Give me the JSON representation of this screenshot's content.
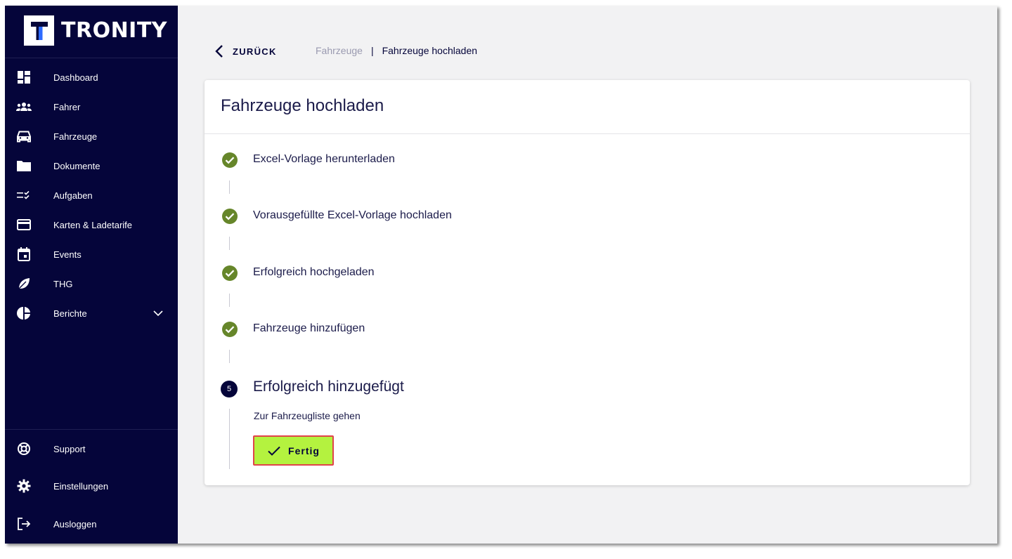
{
  "brand": {
    "logo_letter": "T",
    "name": "TRONITY"
  },
  "sidebar": {
    "items": [
      {
        "label": "Dashboard",
        "icon": "dashboard-icon"
      },
      {
        "label": "Fahrer",
        "icon": "people-icon"
      },
      {
        "label": "Fahrzeuge",
        "icon": "car-icon"
      },
      {
        "label": "Dokumente",
        "icon": "folder-icon"
      },
      {
        "label": "Aufgaben",
        "icon": "checklist-icon"
      },
      {
        "label": "Karten & Ladetarife",
        "icon": "card-icon"
      },
      {
        "label": "Events",
        "icon": "calendar-icon"
      },
      {
        "label": "THG",
        "icon": "leaf-icon"
      },
      {
        "label": "Berichte",
        "icon": "pie-chart-icon"
      }
    ],
    "bottom_items": [
      {
        "label": "Support",
        "icon": "lifebuoy-icon"
      },
      {
        "label": "Einstellungen",
        "icon": "gear-icon"
      },
      {
        "label": "Ausloggen",
        "icon": "logout-icon"
      }
    ]
  },
  "header": {
    "back_label": "ZURÜCK",
    "breadcrumb": {
      "parent": "Fahrzeuge",
      "separator": "|",
      "current": "Fahrzeuge hochladen"
    }
  },
  "card": {
    "title": "Fahrzeuge hochladen",
    "steps": [
      {
        "label": "Excel-Vorlage herunterladen",
        "status": "done"
      },
      {
        "label": "Vorausgefüllte Excel-Vorlage hochladen",
        "status": "done"
      },
      {
        "label": "Erfolgreich hochgeladen",
        "status": "done"
      },
      {
        "label": "Fahrzeuge hinzufügen",
        "status": "done"
      }
    ],
    "active_step": {
      "number": "5",
      "label": "Erfolgreich hinzugefügt",
      "description": "Zur Fahrzeugliste gehen",
      "button_label": "Fertig"
    }
  },
  "colors": {
    "sidebar_bg": "#05053a",
    "done_green": "#66862a",
    "button_bg": "#b4f23f",
    "highlight_border": "#e0434a"
  }
}
